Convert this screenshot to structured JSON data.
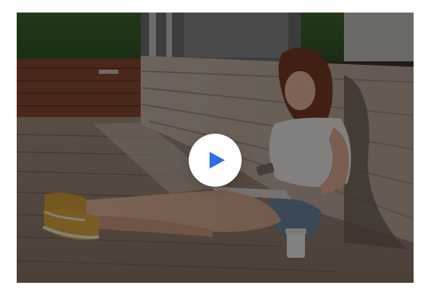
{
  "video": {
    "thumbnail_subject": "woman-with-laptop-and-phone-sitting-on-deck-image",
    "play_button": {
      "icon": "play-icon",
      "icon_color": "#2f6fe6",
      "background_color": "#ffffff"
    },
    "overlay_color": "#000000"
  }
}
